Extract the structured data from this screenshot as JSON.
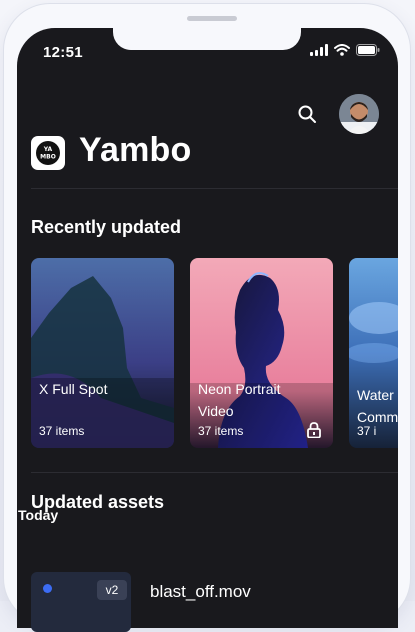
{
  "status_bar": {
    "time": "12:51"
  },
  "app": {
    "title": "Yambo",
    "logo_text": "YAMBO"
  },
  "recently_updated": {
    "title": "Recently updated",
    "cards": [
      {
        "title_lines": [
          "X Full Spot"
        ],
        "count": "37 items",
        "locked": false
      },
      {
        "title_lines": [
          "Neon Portrait",
          "Video"
        ],
        "count": "37 items",
        "locked": true
      },
      {
        "title_lines": [
          "Water",
          "Comm"
        ],
        "count": "37 i",
        "locked": false
      }
    ]
  },
  "updated_assets": {
    "title": "Updated assets",
    "group_label": "Today",
    "items": [
      {
        "name": "blast_off.mov",
        "version": "v2"
      }
    ]
  },
  "colors": {
    "screen_bg": "#19191d",
    "accent_dot": "#3c6cf3"
  }
}
